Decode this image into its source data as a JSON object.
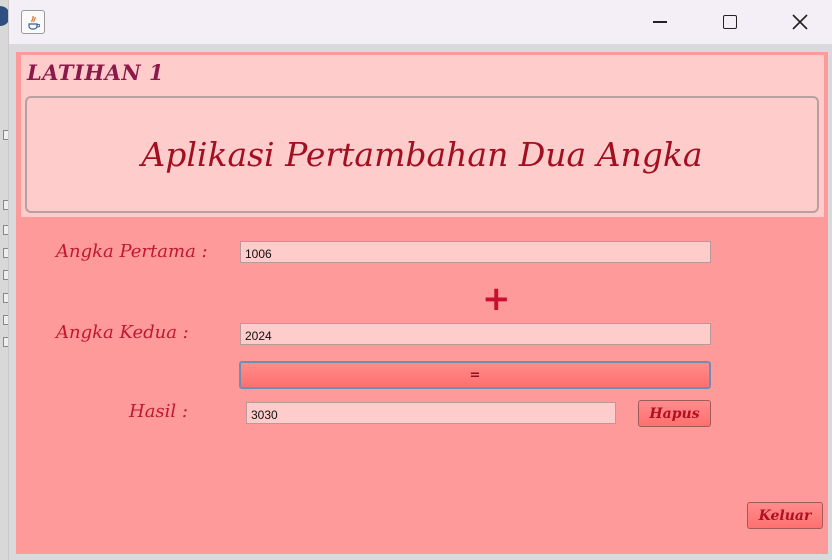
{
  "window": {
    "app_icon": "java-icon",
    "controls": {
      "minimize": "minimize-icon",
      "maximize": "maximize-icon",
      "close": "close-icon"
    }
  },
  "header": {
    "tag": "LATIHAN 1",
    "title": "Aplikasi Pertambahan Dua Angka"
  },
  "form": {
    "first_label": "Angka Pertama :",
    "first_value": "1006",
    "operator": "+",
    "second_label": "Angka Kedua  :",
    "second_value": "2024",
    "equals_label": "=",
    "result_label": "Hasil :",
    "result_value": "3030",
    "clear_label": "Hapus",
    "exit_label": "Keluar"
  },
  "colors": {
    "background": "#ff9a9a",
    "panel": "#ffcccc",
    "title_text": "#a01020",
    "label_text": "#c0182e"
  }
}
